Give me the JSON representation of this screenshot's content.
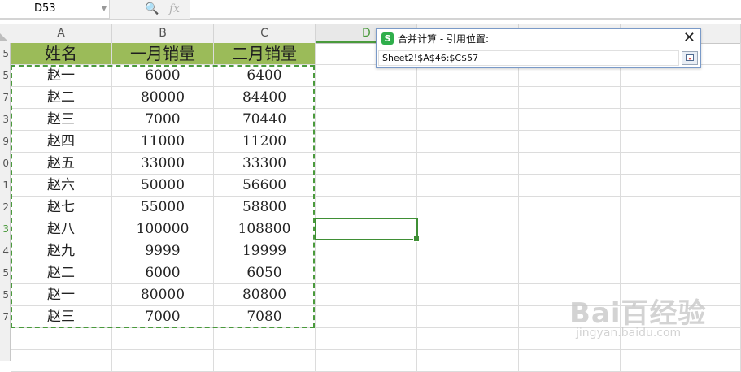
{
  "formula_bar": {
    "name_box": "D53",
    "fx_label": "fx"
  },
  "columns": [
    "A",
    "B",
    "C",
    "D"
  ],
  "active_column": "D",
  "row_numbers": [
    "5",
    "5",
    "7",
    "3",
    "9",
    "0",
    "1",
    "2",
    "3",
    "4",
    "5",
    "5",
    "7"
  ],
  "active_row_index": 7,
  "table": {
    "headers": [
      "姓名",
      "一月销量",
      "二月销量"
    ],
    "rows": [
      [
        "赵一",
        "6000",
        "6400"
      ],
      [
        "赵二",
        "80000",
        "84400"
      ],
      [
        "赵三",
        "7000",
        "70440"
      ],
      [
        "赵四",
        "11000",
        "11200"
      ],
      [
        "赵五",
        "33000",
        "33300"
      ],
      [
        "赵六",
        "50000",
        "56600"
      ],
      [
        "赵七",
        "55000",
        "58800"
      ],
      [
        "赵八",
        "100000",
        "108800"
      ],
      [
        "赵九",
        "9999",
        "19999"
      ],
      [
        "赵二",
        "6000",
        "6050"
      ],
      [
        "赵一",
        "80000",
        "80800"
      ],
      [
        "赵三",
        "7000",
        "7080"
      ]
    ]
  },
  "dialog": {
    "icon_letter": "S",
    "title": "合并计算 - 引用位置:",
    "close_label": "✕",
    "reference_value": "Sheet2!$A$46:$C$57"
  },
  "watermark": {
    "brand": "Bai百经验",
    "url": "jingyan.baidu.com"
  },
  "colors": {
    "header_fill": "#9bbb59",
    "accent_green": "#4a9a3c",
    "app_icon": "#2fae4b"
  }
}
